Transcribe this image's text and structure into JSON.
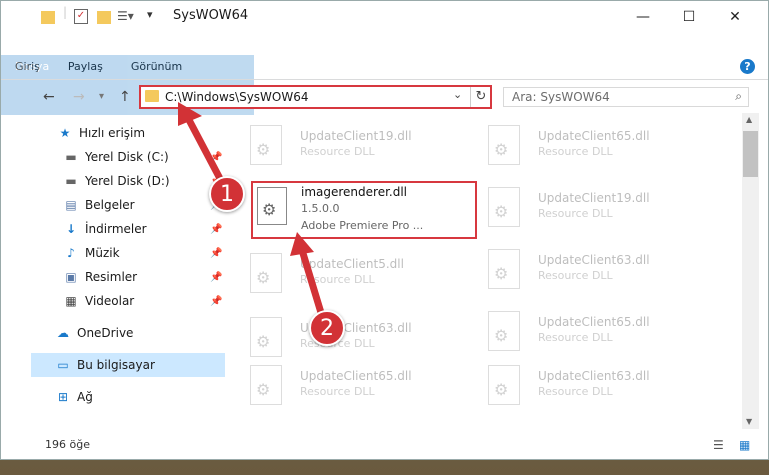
{
  "window": {
    "title": "SysWOW64"
  },
  "ribbon": {
    "tabs": [
      "Dosya",
      "Giriş",
      "Paylaş",
      "Görünüm"
    ],
    "help": "?"
  },
  "address": {
    "path": "C:\\Windows\\SysWOW64"
  },
  "search": {
    "placeholder": "Ara: SysWOW64"
  },
  "sidebar": {
    "items": [
      {
        "label": "Hızlı erişim",
        "icon": "star-icon"
      },
      {
        "label": "Yerel Disk (C:)",
        "icon": "drive-icon"
      },
      {
        "label": "Yerel Disk (D:)",
        "icon": "drive-icon"
      },
      {
        "label": "Belgeler",
        "icon": "document-icon"
      },
      {
        "label": "İndirmeler",
        "icon": "download-icon"
      },
      {
        "label": "Müzik",
        "icon": "music-icon"
      },
      {
        "label": "Resimler",
        "icon": "pictures-icon"
      },
      {
        "label": "Videolar",
        "icon": "video-icon"
      },
      {
        "label": "OneDrive",
        "icon": "cloud-icon"
      },
      {
        "label": "Bu bilgisayar",
        "icon": "computer-icon"
      },
      {
        "label": "Ağ",
        "icon": "network-icon"
      }
    ]
  },
  "files": {
    "left": [
      "UpdateClient19.dll",
      "",
      "UpdateClient5.dll",
      "UpdateClient63.dll",
      "UpdateClient65.dll"
    ],
    "right": [
      "UpdateClient65.dll",
      "UpdateClient19.dll",
      "UpdateClient63.dll",
      "UpdateClient65.dll",
      "UpdateClient63.dll"
    ],
    "type": "Resource DLL"
  },
  "highlighted": {
    "name": "imagerenderer.dll",
    "version": "1.5.0.0",
    "description": "Adobe Premiere Pro ..."
  },
  "status": {
    "count": "196 öğe"
  },
  "annotations": [
    "1",
    "2"
  ],
  "colors": {
    "accent": "#1979ca",
    "highlight": "#d7383f",
    "selected": "#cce8ff"
  }
}
